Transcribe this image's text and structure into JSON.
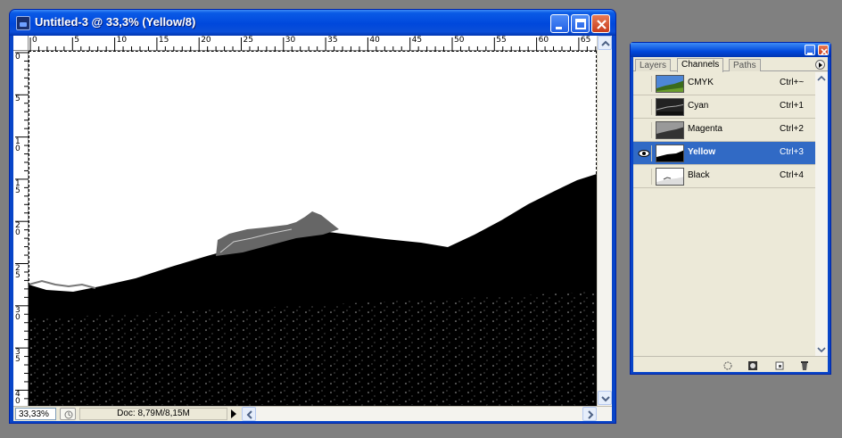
{
  "document": {
    "title": "Untitled-3 @ 33,3% (Yellow/8)",
    "zoom": "33,33%",
    "doc_info": "Doc: 8,79M/8,15M",
    "ruler_h_labels": [
      "0",
      "5",
      "10",
      "15",
      "20",
      "25",
      "30",
      "35",
      "40",
      "45",
      "50",
      "55",
      "60",
      "65"
    ],
    "ruler_v_labels": [
      "0",
      "5",
      "10",
      "15",
      "20",
      "25",
      "30",
      "35",
      "40"
    ]
  },
  "panel": {
    "tabs": [
      {
        "label": "Layers",
        "active": false
      },
      {
        "label": "Channels",
        "active": true
      },
      {
        "label": "Paths",
        "active": false
      }
    ],
    "channels": [
      {
        "name": "CMYK",
        "shortcut": "Ctrl+~",
        "visible": false,
        "selected": false
      },
      {
        "name": "Cyan",
        "shortcut": "Ctrl+1",
        "visible": false,
        "selected": false
      },
      {
        "name": "Magenta",
        "shortcut": "Ctrl+2",
        "visible": false,
        "selected": false
      },
      {
        "name": "Yellow",
        "shortcut": "Ctrl+3",
        "visible": true,
        "selected": true
      },
      {
        "name": "Black",
        "shortcut": "Ctrl+4",
        "visible": false,
        "selected": false
      }
    ],
    "footer_icons": [
      "load-selection-icon",
      "save-selection-icon",
      "new-channel-icon",
      "delete-channel-icon"
    ]
  },
  "colors": {
    "titlebar_blue": "#0a5ae6",
    "selected_row": "#316ac5",
    "panel_bg": "#ece9d8",
    "close_red": "#c93c1c"
  }
}
